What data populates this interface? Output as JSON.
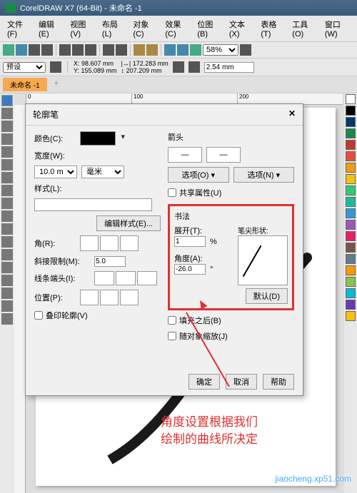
{
  "app": {
    "title": "CorelDRAW X7 (64-Bit) - 未命名 -1"
  },
  "menu": [
    "文件(F)",
    "编辑(E)",
    "视图(V)",
    "布局(L)",
    "对象(C)",
    "效果(C)",
    "位图(B)",
    "文本(X)",
    "表格(T)",
    "工具(O)",
    "窗口(W)"
  ],
  "zoom": "58%",
  "preset_label": "预设",
  "coords": {
    "x": "98.607 mm",
    "y": "155.089 mm",
    "w": "172.283 mm",
    "h": "207.209 mm"
  },
  "stroke_width": "2.54 mm",
  "tab": {
    "name": "未命名 -1",
    "add": "+"
  },
  "ruler": [
    "0",
    "100",
    "200"
  ],
  "dialog": {
    "title": "轮廓笔",
    "close": "✕",
    "color_lbl": "颜色(C):",
    "width_lbl": "宽度(W):",
    "width_val": "10.0 mm",
    "unit": "毫米",
    "style_lbl": "样式(L):",
    "edit_style": "编辑样式(E)...",
    "corner_lbl": "角(R):",
    "miter_lbl": "斜接限制(M):",
    "miter_val": "5.0",
    "lineend_lbl": "线条端头(I):",
    "position_lbl": "位置(P):",
    "overprint": "叠印轮廓(V)",
    "arrows_lbl": "箭头",
    "arrow_dash": "—",
    "options_l": "选项(O)",
    "options_r": "选项(N)",
    "share_attr": "共享属性(U)",
    "calli_lbl": "书法",
    "stretch_lbl": "展开(T):",
    "stretch_val": "1",
    "pct": "%",
    "nib_lbl": "笔尖形状:",
    "angle_lbl": "角度(A):",
    "angle_val": "-26.0",
    "deg": "°",
    "default_btn": "默认(D)",
    "fill_behind": "填充之后(B)",
    "scale_with": "随对象缩放(J)",
    "ok": "确定",
    "cancel": "取消",
    "help": "帮助"
  },
  "annotation": "角度设置根据我们\n绘制的曲线所决定",
  "watermark": "jiaocheng.xp51.com",
  "palette": [
    "#fff",
    "#000",
    "#05386b",
    "#1a8a4a",
    "#c0392b",
    "#e74c3c",
    "#f39c12",
    "#f1c40f",
    "#2ecc71",
    "#1abc9c",
    "#3498db",
    "#9b59b6",
    "#e91e63",
    "#795548",
    "#607d8b",
    "#ff9800",
    "#8bc34a",
    "#00bcd4",
    "#673ab7",
    "#ffc107"
  ]
}
